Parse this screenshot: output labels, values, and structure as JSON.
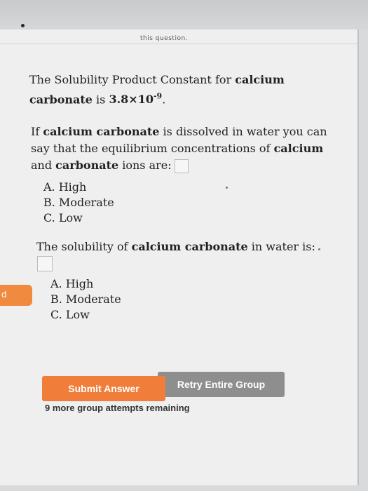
{
  "header": {
    "partial_text": "this question."
  },
  "question1": {
    "pre": "The Solubility Product Constant for ",
    "bold": "calcium carbonate",
    "mid": " is ",
    "value_base": "3.8×10",
    "value_exp": "-9",
    "end": "."
  },
  "question2": {
    "pre": "If ",
    "bold1": "calcium carbonate",
    "mid1": " is dissolved in water you can say that the equilibrium concentrations of ",
    "bold2": "calcium",
    "mid2": " and ",
    "bold3": "carbonate",
    "end": " ions are:",
    "options": [
      "A. High",
      "B. Moderate",
      "C. Low"
    ]
  },
  "question3": {
    "pre": "The solubility of ",
    "bold": "calcium carbonate",
    "end": " in water is:",
    "options": [
      "A. High",
      "B. Moderate",
      "C. Low"
    ]
  },
  "tab": {
    "label": "d"
  },
  "buttons": {
    "submit": "Submit Answer",
    "retry": "Retry Entire Group"
  },
  "status": {
    "remaining": "9 more group attempts remaining"
  }
}
